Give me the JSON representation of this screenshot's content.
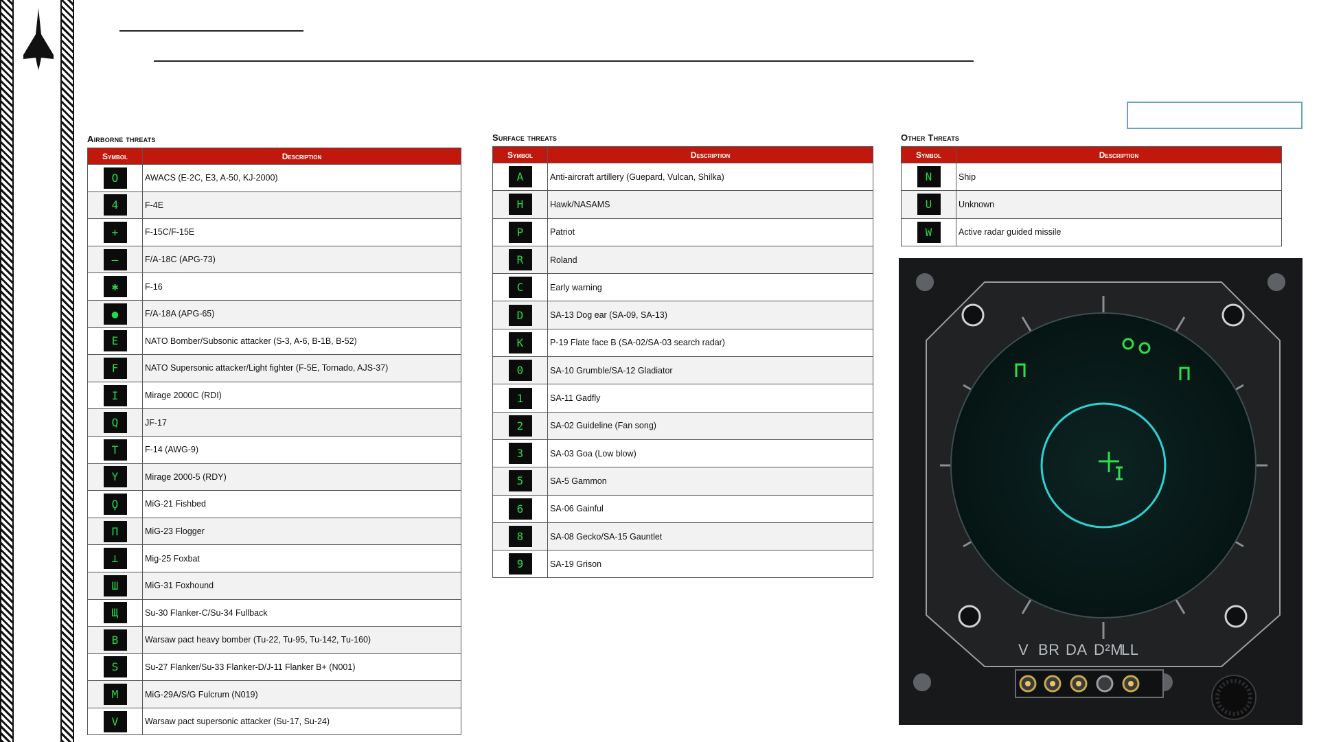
{
  "airborne": {
    "title": "Airborne threats",
    "col_symbol": "Symbol",
    "col_description": "Description",
    "rows": [
      {
        "symbol": "O",
        "description": "AWACS (E-2C, E3, A-50, KJ-2000)"
      },
      {
        "symbol": "4",
        "description": "F-4E"
      },
      {
        "symbol": "+",
        "description": "F-15C/F-15E"
      },
      {
        "symbol": "—",
        "description": "F/A-18C (APG-73)"
      },
      {
        "symbol": "✱",
        "description": "F-16"
      },
      {
        "symbol": "●",
        "description": "F/A-18A (APG-65)"
      },
      {
        "symbol": "E",
        "description": "NATO Bomber/Subsonic attacker (S-3, A-6, B-1B, B-52)"
      },
      {
        "symbol": "F",
        "description": "NATO Supersonic attacker/Light fighter (F-5E, Tornado, AJS-37)"
      },
      {
        "symbol": "I",
        "description": "Mirage 2000C (RDI)"
      },
      {
        "symbol": "Q",
        "description": "JF-17"
      },
      {
        "symbol": "T",
        "description": "F-14 (AWG-9)"
      },
      {
        "symbol": "Y",
        "description": "Mirage 2000-5 (RDY)"
      },
      {
        "symbol": "Ϙ",
        "description": "MiG-21 Fishbed"
      },
      {
        "symbol": "Π",
        "description": "MiG-23 Flogger"
      },
      {
        "symbol": "⊥",
        "description": "Mig-25 Foxbat"
      },
      {
        "symbol": "Ш",
        "description": "MiG-31 Foxhound"
      },
      {
        "symbol": "Щ",
        "description": "Su-30 Flanker-C/Su-34 Fullback"
      },
      {
        "symbol": "B",
        "description": "Warsaw pact heavy bomber (Tu-22, Tu-95, Tu-142, Tu-160)"
      },
      {
        "symbol": "S",
        "description": "Su-27 Flanker/Su-33 Flanker-D/J-11 Flanker B+ (N001)"
      },
      {
        "symbol": "M",
        "description": "MiG-29A/S/G Fulcrum (N019)"
      },
      {
        "symbol": "V",
        "description": "Warsaw pact supersonic attacker (Su-17, Su-24)"
      }
    ]
  },
  "surface": {
    "title": "Surface threats",
    "col_symbol": "Symbol",
    "col_description": "Description",
    "rows": [
      {
        "symbol": "A",
        "description": "Anti-aircraft artillery (Guepard, Vulcan, Shilka)"
      },
      {
        "symbol": "H",
        "description": "Hawk/NASAMS"
      },
      {
        "symbol": "P",
        "description": "Patriot"
      },
      {
        "symbol": "R",
        "description": "Roland"
      },
      {
        "symbol": "C",
        "description": "Early warning"
      },
      {
        "symbol": "D",
        "description": "SA-13 Dog ear (SA-09, SA-13)"
      },
      {
        "symbol": "K",
        "description": "P-19 Flate face B (SA-02/SA-03 search radar)"
      },
      {
        "symbol": "0",
        "description": "SA-10 Grumble/SA-12 Gladiator"
      },
      {
        "symbol": "1",
        "description": "SA-11 Gadfly"
      },
      {
        "symbol": "2",
        "description": "SA-02 Guideline (Fan song)"
      },
      {
        "symbol": "3",
        "description": "SA-03 Goa (Low blow)"
      },
      {
        "symbol": "5",
        "description": "SA-5 Gammon"
      },
      {
        "symbol": "6",
        "description": "SA-06 Gainful"
      },
      {
        "symbol": "8",
        "description": "SA-08 Gecko/SA-15 Gauntlet"
      },
      {
        "symbol": "9",
        "description": "SA-19 Grison"
      }
    ]
  },
  "other": {
    "title": "Other Threats",
    "col_symbol": "Symbol",
    "col_description": "Description",
    "rows": [
      {
        "symbol": "N",
        "description": "Ship"
      },
      {
        "symbol": "U",
        "description": "Unknown"
      },
      {
        "symbol": "W",
        "description": "Active radar guided missile"
      }
    ]
  },
  "radar": {
    "buttons": [
      "V",
      "BR",
      "DA",
      "D²M",
      "LL"
    ],
    "contact_symbols": [
      "O",
      "O",
      "Π",
      "Π",
      "+",
      "I"
    ],
    "colors": {
      "scope_green": "#2be04a",
      "ring_cyan": "#2ed1d6",
      "panel": "#18191b"
    }
  },
  "colors": {
    "header_red": "#c0180c",
    "symbol_green": "#27d84a"
  }
}
